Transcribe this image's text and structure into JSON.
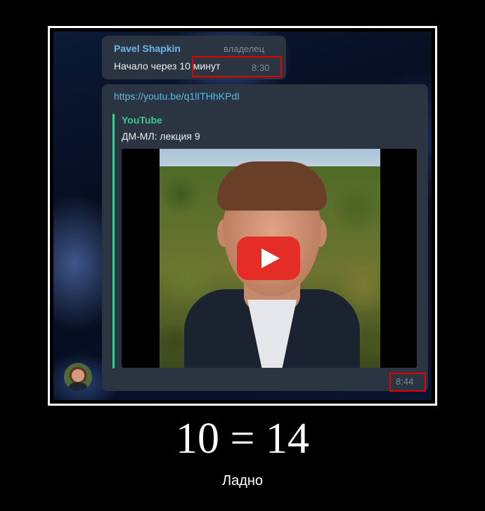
{
  "message1": {
    "sender": "Pavel Shapkin",
    "role": "владелец",
    "text": "Начало через 10 минут",
    "time": "8:30"
  },
  "message2": {
    "link": "https://youtu.be/q1lITHhKPdI",
    "preview_site": "YouTube",
    "preview_title": "ДМ-МЛ: лекция 9",
    "time": "8:44"
  },
  "caption": {
    "main": "10 = 14",
    "sub": "Ладно"
  },
  "colors": {
    "highlight": "#e30000",
    "link": "#5ab9ea",
    "sender": "#6ab7f0",
    "preview_accent": "#3fc79a",
    "bubble": "#2b3541"
  },
  "icons": {
    "play": "youtube-play-icon"
  }
}
